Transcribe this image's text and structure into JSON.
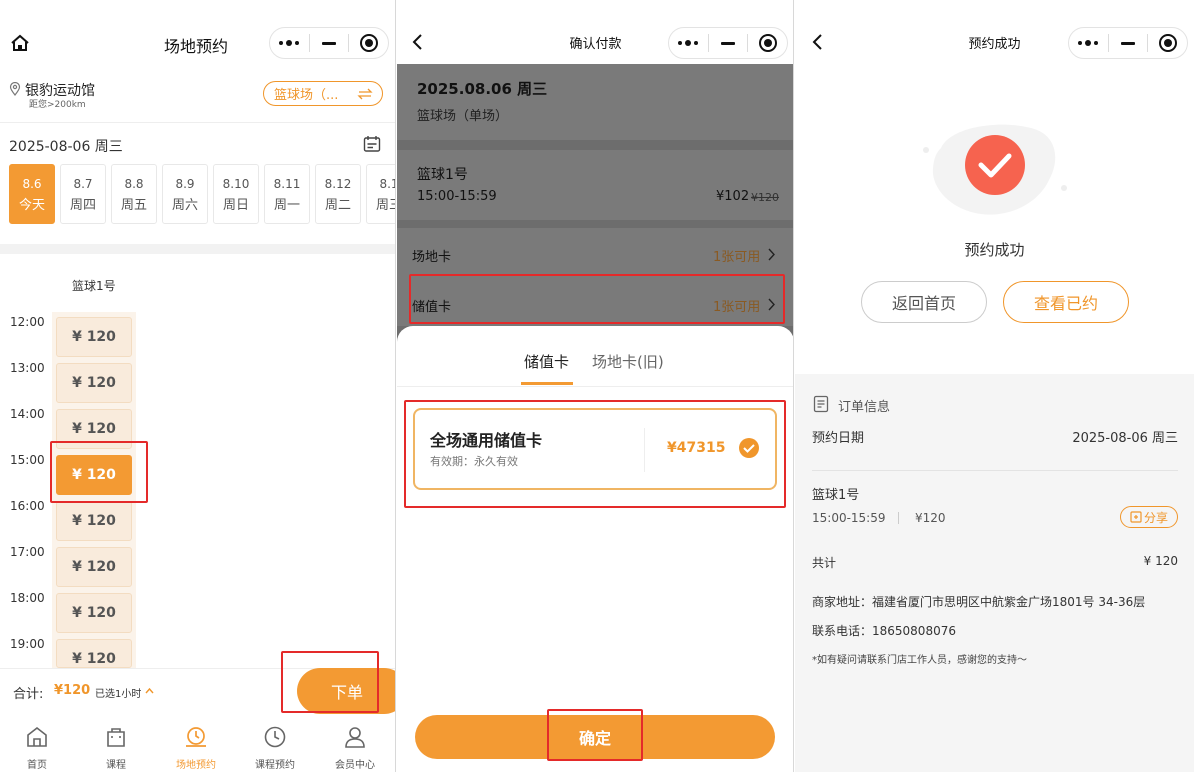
{
  "panel1": {
    "title": "场地预约",
    "venue_name": "银豹运动馆",
    "venue_distance": "距您>200km",
    "sport_selector": "篮球场（...",
    "date_label": "2025-08-06 周三",
    "days": [
      {
        "date": "8.6",
        "week": "今天",
        "active": true
      },
      {
        "date": "8.7",
        "week": "周四"
      },
      {
        "date": "8.8",
        "week": "周五"
      },
      {
        "date": "8.9",
        "week": "周六"
      },
      {
        "date": "8.10",
        "week": "周日"
      },
      {
        "date": "8.11",
        "week": "周一"
      },
      {
        "date": "8.12",
        "week": "周二"
      },
      {
        "date": "8.1",
        "week": "周三"
      }
    ],
    "court_name": "篮球1号",
    "hours": [
      "12:00",
      "13:00",
      "14:00",
      "15:00",
      "16:00",
      "17:00",
      "18:00",
      "19:00"
    ],
    "slot_price": "¥ 120",
    "total_label": "合计:",
    "total_value": "¥120",
    "selected_label": "已选1小时",
    "order_button": "下单",
    "tabs": [
      "首页",
      "课程",
      "场地预约",
      "课程预约",
      "会员中心"
    ]
  },
  "panel2": {
    "title": "确认付款",
    "date_line": "2025.08.06 周三",
    "venue_type": "篮球场（单场）",
    "court": "篮球1号",
    "time": "15:00-15:59",
    "price": "¥102",
    "original_price": "¥120",
    "venue_card_label": "场地卡",
    "venue_card_count": "1张可用",
    "stored_card_label": "储值卡",
    "stored_card_count": "1张可用",
    "sheet_tabs": [
      "储值卡",
      "场地卡(旧)"
    ],
    "card_name": "全场通用储值卡",
    "card_validity": "有效期：永久有效",
    "card_balance": "¥47315",
    "confirm_button": "确定"
  },
  "panel3": {
    "title": "预约成功",
    "status_text": "预约成功",
    "home_button": "返回首页",
    "view_button": "查看已约",
    "order_info_title": "订单信息",
    "booking_date_label": "预约日期",
    "booking_date_value": "2025-08-06 周三",
    "court": "篮球1号",
    "time": "15:00-15:59",
    "price": "¥120",
    "share_button": "分享",
    "total_label": "共计",
    "total_value": "¥ 120",
    "address": "商家地址：福建省厦门市思明区中航紫金广场1801号 34-36层",
    "phone": "联系电话：18650808076",
    "note": "*如有疑问请联系门店工作人员，感谢您的支持～"
  }
}
